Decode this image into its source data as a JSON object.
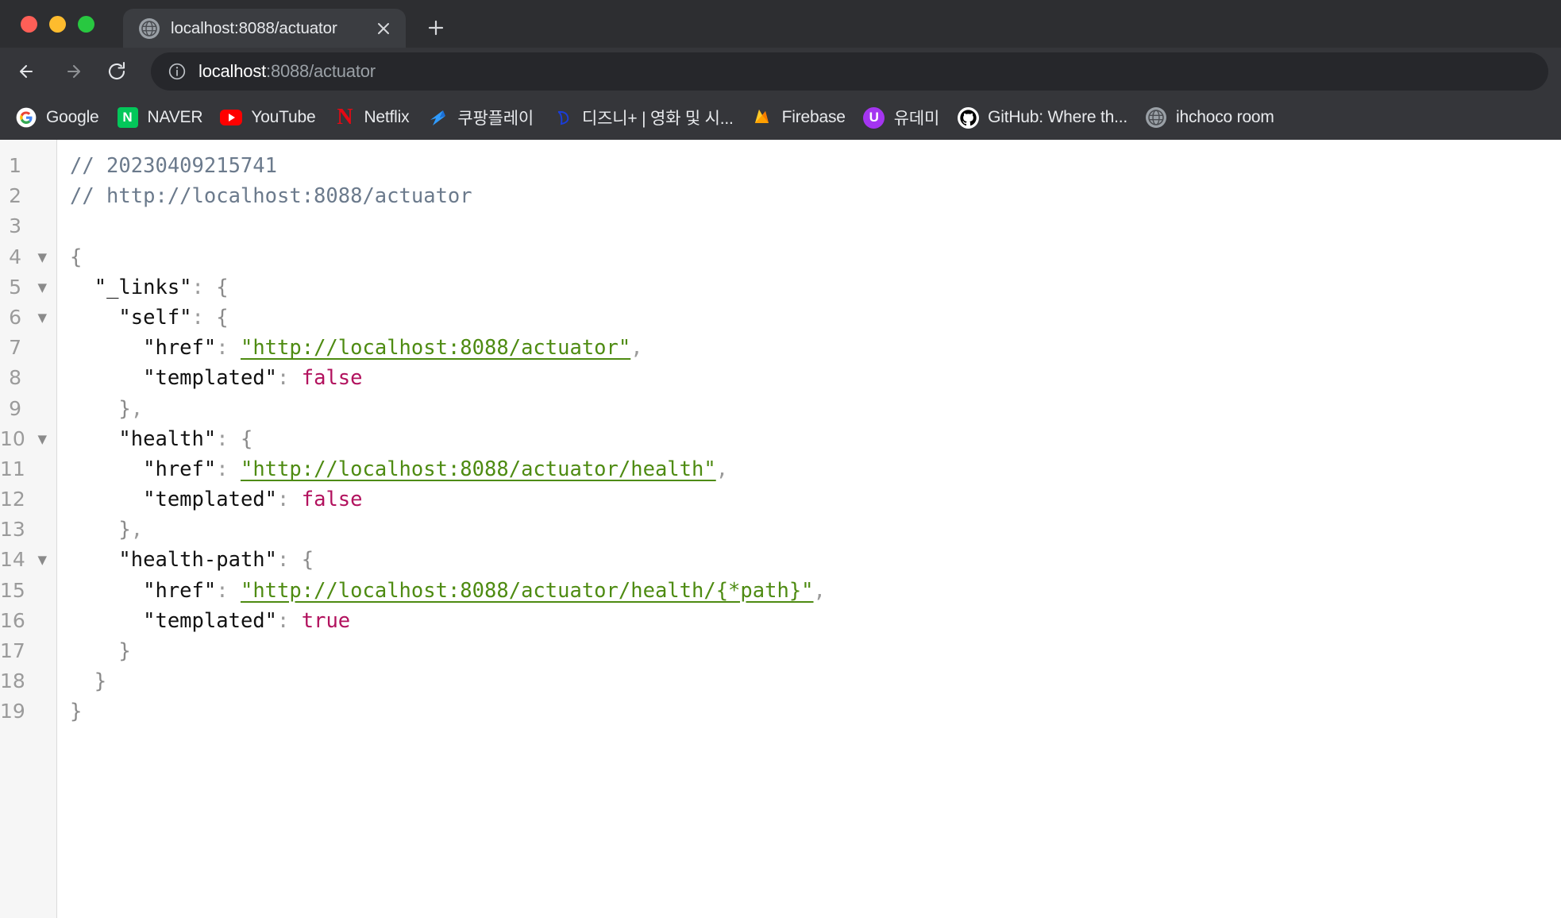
{
  "window": {
    "traffic_lights": [
      "close",
      "minimize",
      "maximize"
    ],
    "colors": {
      "tabstrip_bg": "#2d2e31",
      "toolbar_bg": "#35363a",
      "active_tab_bg": "#3b3d41",
      "omnibox_bg": "#26272b",
      "url_string": "#4e8b12",
      "boolean": "#b2125e",
      "comment": "#6b7a8c"
    }
  },
  "tabstrip": {
    "active_tab": {
      "title": "localhost:8088/actuator",
      "favicon": "globe-icon",
      "close_label": "✕"
    },
    "new_tab_label": "+"
  },
  "toolbar": {
    "back_label": "←",
    "forward_label": "→",
    "reload_label": "⟳",
    "omnibox": {
      "info_icon": "info-circle-icon",
      "host": "localhost",
      "path": ":8088/actuator",
      "full_url": "localhost:8088/actuator"
    }
  },
  "bookmarks": [
    {
      "label": "Google",
      "icon": "google-icon"
    },
    {
      "label": "NAVER",
      "icon": "naver-icon"
    },
    {
      "label": "YouTube",
      "icon": "youtube-icon"
    },
    {
      "label": "Netflix",
      "icon": "netflix-icon"
    },
    {
      "label": "쿠팡플레이",
      "icon": "coupang-play-icon"
    },
    {
      "label": "디즈니+ | 영화 및 시...",
      "icon": "disney-plus-icon"
    },
    {
      "label": "Firebase",
      "icon": "firebase-icon"
    },
    {
      "label": "유데미",
      "icon": "udemy-icon"
    },
    {
      "label": "GitHub: Where th...",
      "icon": "github-icon"
    },
    {
      "label": "ihchoco room",
      "icon": "globe-icon"
    }
  ],
  "viewer": {
    "line_numbers": [
      "1",
      "2",
      "3",
      "4",
      "5",
      "6",
      "7",
      "8",
      "9",
      "10",
      "11",
      "12",
      "13",
      "14",
      "15",
      "16",
      "17",
      "18",
      "19"
    ],
    "fold_lines": [
      "4",
      "5",
      "6",
      "10",
      "14"
    ],
    "fold_glyph": "▼",
    "lines": [
      {
        "n": "1",
        "indent": 0,
        "tokens": [
          {
            "t": "comment",
            "v": "// 20230409215741"
          }
        ]
      },
      {
        "n": "2",
        "indent": 0,
        "tokens": [
          {
            "t": "comment",
            "v": "// http://localhost:8088/actuator"
          }
        ]
      },
      {
        "n": "3",
        "indent": 0,
        "tokens": []
      },
      {
        "n": "4",
        "indent": 0,
        "tokens": [
          {
            "t": "brace",
            "v": "{"
          }
        ]
      },
      {
        "n": "5",
        "indent": 1,
        "tokens": [
          {
            "t": "key",
            "v": "\"_links\""
          },
          {
            "t": "punc",
            "v": ":"
          },
          {
            "t": "plain",
            "v": " "
          },
          {
            "t": "brace",
            "v": "{"
          }
        ]
      },
      {
        "n": "6",
        "indent": 2,
        "tokens": [
          {
            "t": "key",
            "v": "\"self\""
          },
          {
            "t": "punc",
            "v": ":"
          },
          {
            "t": "plain",
            "v": " "
          },
          {
            "t": "brace",
            "v": "{"
          }
        ]
      },
      {
        "n": "7",
        "indent": 3,
        "tokens": [
          {
            "t": "key",
            "v": "\"href\""
          },
          {
            "t": "punc",
            "v": ":"
          },
          {
            "t": "plain",
            "v": " "
          },
          {
            "t": "url",
            "v": "\"http://localhost:8088/actuator\""
          },
          {
            "t": "punc",
            "v": ","
          }
        ]
      },
      {
        "n": "8",
        "indent": 3,
        "tokens": [
          {
            "t": "key",
            "v": "\"templated\""
          },
          {
            "t": "punc",
            "v": ":"
          },
          {
            "t": "plain",
            "v": " "
          },
          {
            "t": "bool",
            "v": "false"
          }
        ]
      },
      {
        "n": "9",
        "indent": 2,
        "tokens": [
          {
            "t": "brace",
            "v": "}"
          },
          {
            "t": "punc",
            "v": ","
          }
        ]
      },
      {
        "n": "10",
        "indent": 2,
        "tokens": [
          {
            "t": "key",
            "v": "\"health\""
          },
          {
            "t": "punc",
            "v": ":"
          },
          {
            "t": "plain",
            "v": " "
          },
          {
            "t": "brace",
            "v": "{"
          }
        ]
      },
      {
        "n": "11",
        "indent": 3,
        "tokens": [
          {
            "t": "key",
            "v": "\"href\""
          },
          {
            "t": "punc",
            "v": ":"
          },
          {
            "t": "plain",
            "v": " "
          },
          {
            "t": "url",
            "v": "\"http://localhost:8088/actuator/health\""
          },
          {
            "t": "punc",
            "v": ","
          }
        ]
      },
      {
        "n": "12",
        "indent": 3,
        "tokens": [
          {
            "t": "key",
            "v": "\"templated\""
          },
          {
            "t": "punc",
            "v": ":"
          },
          {
            "t": "plain",
            "v": " "
          },
          {
            "t": "bool",
            "v": "false"
          }
        ]
      },
      {
        "n": "13",
        "indent": 2,
        "tokens": [
          {
            "t": "brace",
            "v": "}"
          },
          {
            "t": "punc",
            "v": ","
          }
        ]
      },
      {
        "n": "14",
        "indent": 2,
        "tokens": [
          {
            "t": "key",
            "v": "\"health-path\""
          },
          {
            "t": "punc",
            "v": ":"
          },
          {
            "t": "plain",
            "v": " "
          },
          {
            "t": "brace",
            "v": "{"
          }
        ]
      },
      {
        "n": "15",
        "indent": 3,
        "tokens": [
          {
            "t": "key",
            "v": "\"href\""
          },
          {
            "t": "punc",
            "v": ":"
          },
          {
            "t": "plain",
            "v": " "
          },
          {
            "t": "url",
            "v": "\"http://localhost:8088/actuator/health/{*path}\""
          },
          {
            "t": "punc",
            "v": ","
          }
        ]
      },
      {
        "n": "16",
        "indent": 3,
        "tokens": [
          {
            "t": "key",
            "v": "\"templated\""
          },
          {
            "t": "punc",
            "v": ":"
          },
          {
            "t": "plain",
            "v": " "
          },
          {
            "t": "bool",
            "v": "true"
          }
        ]
      },
      {
        "n": "17",
        "indent": 2,
        "tokens": [
          {
            "t": "brace",
            "v": "}"
          }
        ]
      },
      {
        "n": "18",
        "indent": 1,
        "tokens": [
          {
            "t": "brace",
            "v": "}"
          }
        ]
      },
      {
        "n": "19",
        "indent": 0,
        "tokens": [
          {
            "t": "brace",
            "v": "}"
          }
        ]
      }
    ]
  }
}
